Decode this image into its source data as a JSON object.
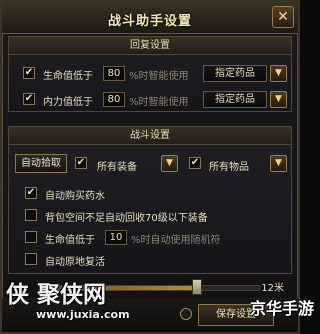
{
  "window": {
    "title": "战斗助手设置",
    "close_glyph": "✕"
  },
  "recovery": {
    "header": "回复设置",
    "rows": [
      {
        "label": "生命值低于",
        "value": "80",
        "suffix": "%时智能使用",
        "dropdown": "指定药品",
        "checked": true
      },
      {
        "label": "内力值低于",
        "value": "80",
        "suffix": "%时智能使用",
        "dropdown": "指定药品",
        "checked": true
      }
    ]
  },
  "combat": {
    "header": "战斗设置",
    "auto_pick_label": "自动拾取",
    "equip_filter": "所有装备",
    "item_filter": "所有物品",
    "options": [
      {
        "label": "自动购买药水",
        "checked": true
      },
      {
        "label": "背包空间不足自动回收70级以下装备",
        "checked": false
      },
      {
        "label": "生命值低于",
        "value": "10",
        "suffix": "%时自动使用随机符",
        "checked": false
      },
      {
        "label": "自动原地复活",
        "checked": false
      }
    ]
  },
  "range": {
    "label": "12米",
    "fraction": 0.72
  },
  "footer": {
    "save_label": "保存设置"
  },
  "watermark": {
    "logo": "侠 聚侠网",
    "url": "www.juxia.com",
    "brand": "京华手游"
  },
  "icons": {
    "check": "✔",
    "dropdown_arrow": "▼"
  },
  "colors": {
    "accent_gold": "#b08a4a",
    "text": "#e6dcc0"
  }
}
